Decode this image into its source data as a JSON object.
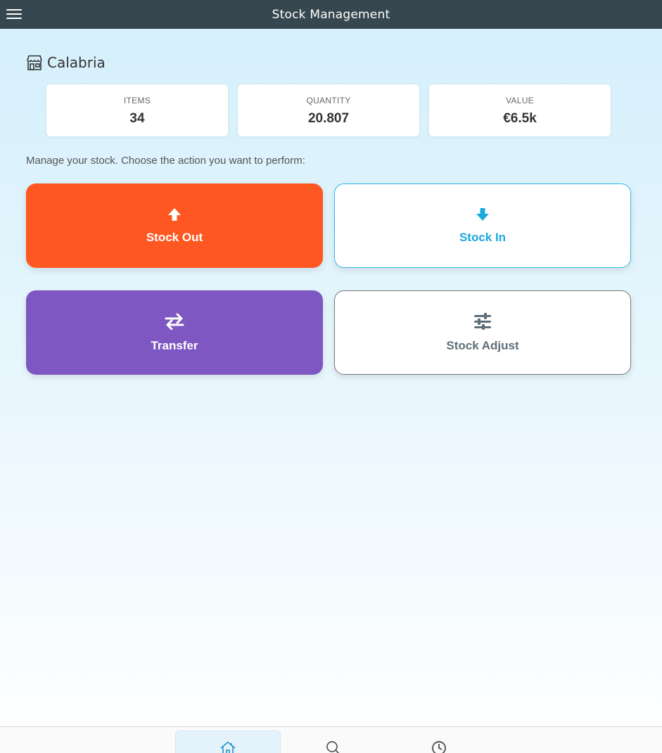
{
  "app": {
    "title": "Stock Management"
  },
  "store": {
    "name": "Calabria",
    "icon": "store-icon"
  },
  "stats": [
    {
      "label": "ITEMS",
      "value": "34"
    },
    {
      "label": "QUANTITY",
      "value": "20.807"
    },
    {
      "label": "VALUE",
      "value": "€6.5k"
    }
  ],
  "instructions": "Manage your stock. Choose the action you want to perform:",
  "actions": {
    "stock_out": {
      "label": "Stock Out",
      "icon": "arrow-up-icon",
      "color": "#ff5722"
    },
    "stock_in": {
      "label": "Stock In",
      "icon": "arrow-down-icon",
      "color": "#1ba9dd"
    },
    "transfer": {
      "label": "Transfer",
      "icon": "transfer-icon",
      "color": "#7e57c2"
    },
    "stock_adjust": {
      "label": "Stock Adjust",
      "icon": "sliders-icon",
      "color": "#5f6f78"
    }
  },
  "bottom_nav": [
    {
      "name": "home",
      "icon": "home-icon",
      "active": true
    },
    {
      "name": "search",
      "icon": "search-icon",
      "active": false
    },
    {
      "name": "history",
      "icon": "clock-icon",
      "active": false
    }
  ]
}
